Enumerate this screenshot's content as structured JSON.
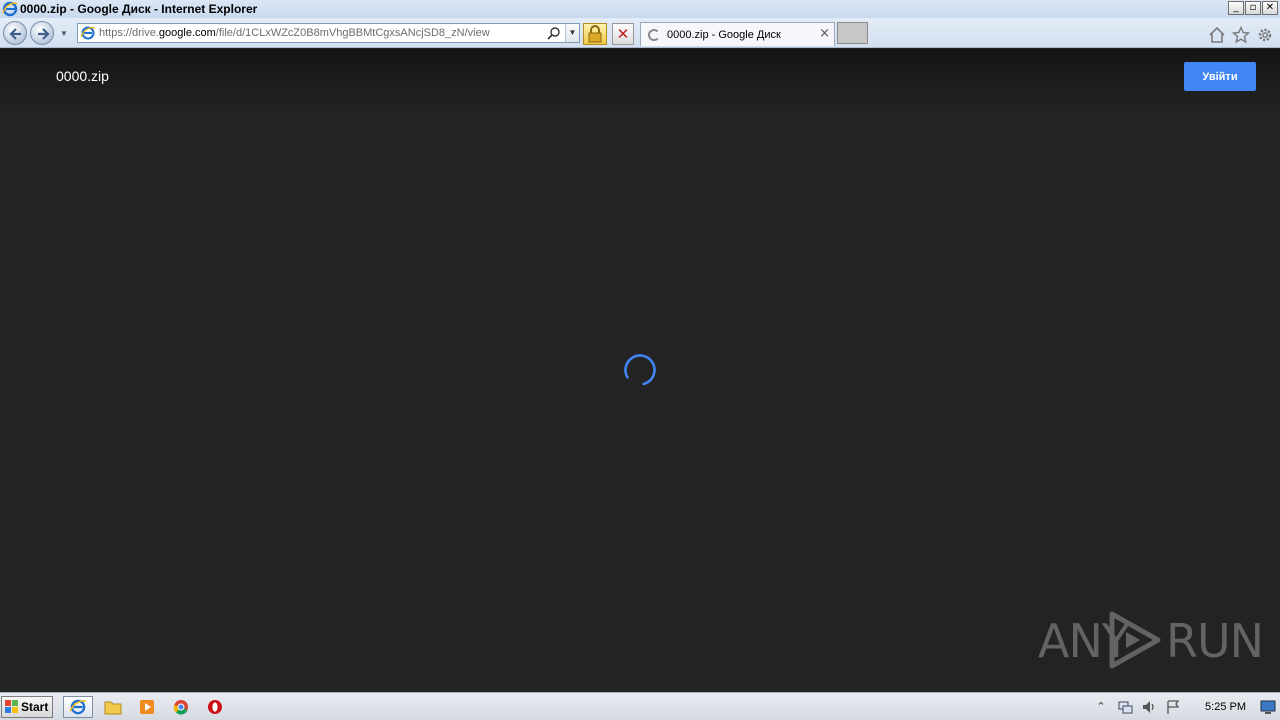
{
  "window": {
    "title": "0000.zip - Google Диск - Internet Explorer",
    "controls": {
      "minimize": "_",
      "restore": "▫",
      "close": "✕"
    }
  },
  "address_bar": {
    "url_prefix": "https://drive.",
    "url_host": "google.com",
    "url_path": "/file/d/1CLxWZcZ0B8mVhgBBMtCgxsANcjSD8_zN/view"
  },
  "tab": {
    "label": "0000.zip - Google Диск",
    "close": "×"
  },
  "viewer": {
    "file_name": "0000.zip",
    "signin_label": "Увійти"
  },
  "watermark": {
    "left_text": "ANY",
    "right_text": "RUN"
  },
  "taskbar": {
    "start_label": "Start",
    "clock": "5:25 PM"
  },
  "colors": {
    "background": "#232323",
    "accent": "#4285f4",
    "spinner": "#4285f4"
  }
}
